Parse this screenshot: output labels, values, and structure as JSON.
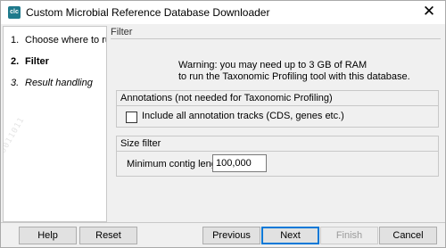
{
  "window": {
    "title": "Custom Microbial Reference Database Downloader",
    "app_icon": "clc-app-icon"
  },
  "steps": [
    {
      "num": "1.",
      "label": "Choose where to run",
      "state": "done"
    },
    {
      "num": "2.",
      "label": "Filter",
      "state": "active"
    },
    {
      "num": "3.",
      "label": "Result handling",
      "state": "future"
    }
  ],
  "watermark": "0101010010100011011",
  "section": {
    "title": "Filter"
  },
  "warning": {
    "line1": "Warning: you may need up to 3 GB of RAM",
    "line2": "to run the Taxonomic Profiling tool with this database."
  },
  "annotations": {
    "title": "Annotations (not needed for Taxonomic Profiling)",
    "checkbox_label": "Include all annotation tracks (CDS, genes etc.)",
    "checked": false
  },
  "size_filter": {
    "title": "Size filter",
    "field_label": "Minimum contig length",
    "value": "100,000"
  },
  "buttons": {
    "help": "Help",
    "reset": "Reset",
    "previous": "Previous",
    "next": "Next",
    "finish": "Finish",
    "cancel": "Cancel"
  },
  "colors": {
    "accent": "#0078d7",
    "disabled_text": "#9a9a9a"
  }
}
